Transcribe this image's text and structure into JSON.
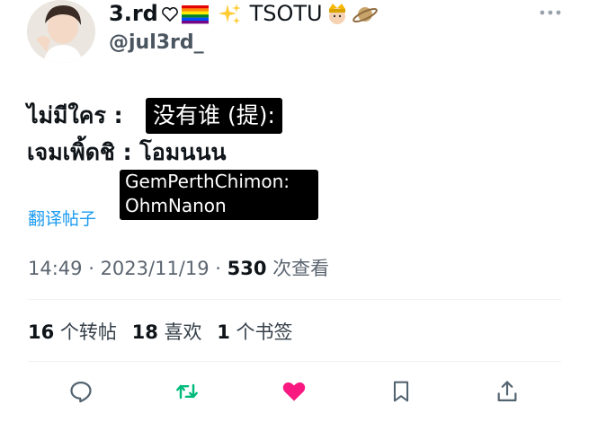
{
  "author": {
    "display_name": "3.rd",
    "display_name_suffix": "TSOTU",
    "handle": "@jul3rd_",
    "emojis": [
      "white-heart",
      "rainbow-flag",
      "sparkles",
      "prince",
      "ringed-planet"
    ]
  },
  "content": {
    "line1_thai": "ไม่มีใคร :",
    "line1_sub": "没有谁 (提):",
    "line2_thai": "เจมเพิ้ดชิ : โอมนนน",
    "line2_sub_a": "GemPerthChimon:",
    "line2_sub_b": "OhmNanon"
  },
  "translate_label": "翻译帖子",
  "meta": {
    "time": "14:49",
    "sep1": " · ",
    "date": "2023/11/19",
    "sep2": " · ",
    "views_count": "530",
    "views_label": " 次查看"
  },
  "stats": {
    "reposts_count": "16",
    "reposts_label": " 个转帖",
    "likes_count": "18",
    "likes_label": " 喜欢",
    "bookmarks_count": "1",
    "bookmarks_label": " 个书签"
  },
  "actions": [
    "reply",
    "repost",
    "like",
    "bookmark",
    "share"
  ],
  "colors": {
    "link": "#1d9bf0",
    "repost_active": "#00ba7c",
    "like_active": "#f91880",
    "icon_default": "#536471"
  }
}
